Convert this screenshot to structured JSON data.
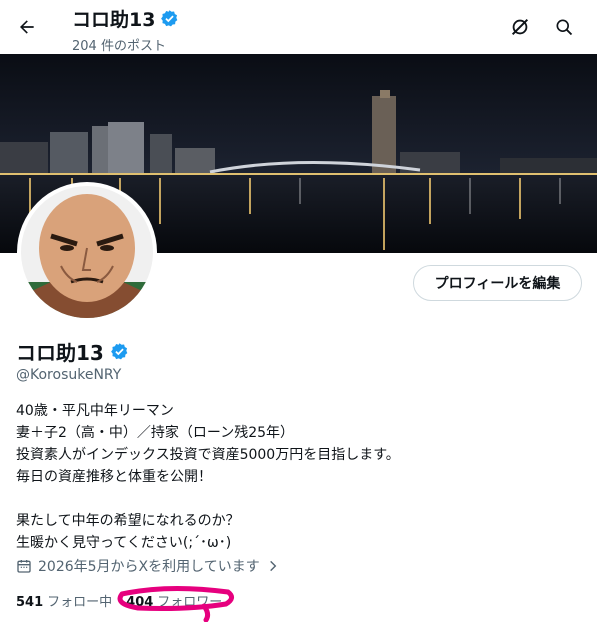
{
  "header": {
    "name": "コロ助13",
    "post_count": "204 件のポスト",
    "icons": [
      "back-arrow-icon",
      "verified-icon",
      "grok-icon",
      "search-icon"
    ]
  },
  "profile": {
    "display_name": "コロ助13",
    "handle": "@KorosukeNRY",
    "edit_label": "プロフィールを編集",
    "bio_lines": [
      "40歳・平凡中年リーマン",
      "妻＋子2（高・中）／持家（ローン残25年）",
      "投資素人がインデックス投資で資産5000万円を目指します。",
      "毎日の資産推移と体重を公開！",
      "",
      "果たして中年の希望になれるのか？",
      "生暖かく見守ってください(;´･ω･)"
    ],
    "joined": "2026年5月からXを利用しています",
    "following_count": "541",
    "following_label": "フォロー中",
    "followers_count": "404",
    "followers_label": "フォロワー"
  },
  "colors": {
    "verified": "#1d9bf0",
    "highlight": "#e6007e",
    "secondary_text": "#536471"
  }
}
